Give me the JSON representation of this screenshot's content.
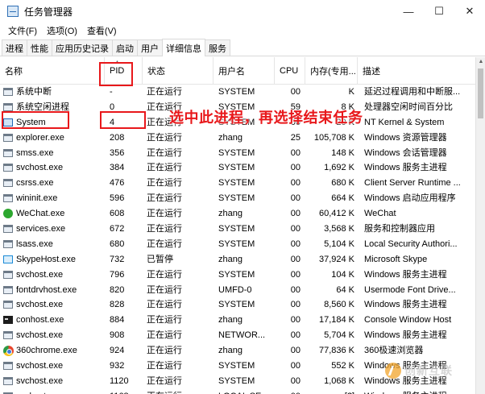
{
  "window": {
    "title": "任务管理器",
    "controls": {
      "minimize": "—",
      "maximize": "☐",
      "close": "✕"
    }
  },
  "menubar": {
    "items": [
      "文件(F)",
      "选项(O)",
      "查看(V)"
    ]
  },
  "tabs": [
    {
      "label": "进程",
      "active": false
    },
    {
      "label": "性能",
      "active": false
    },
    {
      "label": "应用历史记录",
      "active": false
    },
    {
      "label": "启动",
      "active": false
    },
    {
      "label": "用户",
      "active": false
    },
    {
      "label": "详细信息",
      "active": true
    },
    {
      "label": "服务",
      "active": false
    }
  ],
  "table": {
    "columns": {
      "name": "名称",
      "pid": "PID",
      "status": "状态",
      "user": "用户名",
      "cpu": "CPU",
      "mem": "内存(专用...",
      "desc": "描述"
    },
    "sort_indicator": "▲",
    "rows": [
      {
        "icon": "generic",
        "name": "系统中断",
        "pid": "-",
        "status": "正在运行",
        "user": "SYSTEM",
        "cpu": "00",
        "mem": "K",
        "desc": "延迟过程调用和中断服..."
      },
      {
        "icon": "generic",
        "name": "系统空闲进程",
        "pid": "0",
        "status": "正在运行",
        "user": "SYSTEM",
        "cpu": "59",
        "mem": "8 K",
        "desc": "处理器空闲时间百分比"
      },
      {
        "icon": "sys",
        "name": "System",
        "pid": "4",
        "status": "正在运行",
        "user": "SYSTEM",
        "cpu": "00",
        "mem": "20 K",
        "desc": "NT Kernel & System"
      },
      {
        "icon": "generic",
        "name": "explorer.exe",
        "pid": "208",
        "status": "正在运行",
        "user": "zhang",
        "cpu": "25",
        "mem": "105,708 K",
        "desc": "Windows 资源管理器"
      },
      {
        "icon": "generic",
        "name": "smss.exe",
        "pid": "356",
        "status": "正在运行",
        "user": "SYSTEM",
        "cpu": "00",
        "mem": "148 K",
        "desc": "Windows 会话管理器"
      },
      {
        "icon": "generic",
        "name": "svchost.exe",
        "pid": "384",
        "status": "正在运行",
        "user": "SYSTEM",
        "cpu": "00",
        "mem": "1,692 K",
        "desc": "Windows 服务主进程"
      },
      {
        "icon": "generic",
        "name": "csrss.exe",
        "pid": "476",
        "status": "正在运行",
        "user": "SYSTEM",
        "cpu": "00",
        "mem": "680 K",
        "desc": "Client Server Runtime ..."
      },
      {
        "icon": "generic",
        "name": "wininit.exe",
        "pid": "596",
        "status": "正在运行",
        "user": "SYSTEM",
        "cpu": "00",
        "mem": "664 K",
        "desc": "Windows 启动应用程序"
      },
      {
        "icon": "wechat",
        "name": "WeChat.exe",
        "pid": "608",
        "status": "正在运行",
        "user": "zhang",
        "cpu": "00",
        "mem": "60,412 K",
        "desc": "WeChat"
      },
      {
        "icon": "generic",
        "name": "services.exe",
        "pid": "672",
        "status": "正在运行",
        "user": "SYSTEM",
        "cpu": "00",
        "mem": "3,568 K",
        "desc": "服务和控制器应用"
      },
      {
        "icon": "generic",
        "name": "lsass.exe",
        "pid": "680",
        "status": "正在运行",
        "user": "SYSTEM",
        "cpu": "00",
        "mem": "5,104 K",
        "desc": "Local Security Authori..."
      },
      {
        "icon": "skype",
        "name": "SkypeHost.exe",
        "pid": "732",
        "status": "已暂停",
        "user": "zhang",
        "cpu": "00",
        "mem": "37,924 K",
        "desc": "Microsoft Skype"
      },
      {
        "icon": "generic",
        "name": "svchost.exe",
        "pid": "796",
        "status": "正在运行",
        "user": "SYSTEM",
        "cpu": "00",
        "mem": "104 K",
        "desc": "Windows 服务主进程"
      },
      {
        "icon": "generic",
        "name": "fontdrvhost.exe",
        "pid": "820",
        "status": "正在运行",
        "user": "UMFD-0",
        "cpu": "00",
        "mem": "64 K",
        "desc": "Usermode Font Drive..."
      },
      {
        "icon": "generic",
        "name": "svchost.exe",
        "pid": "828",
        "status": "正在运行",
        "user": "SYSTEM",
        "cpu": "00",
        "mem": "8,560 K",
        "desc": "Windows 服务主进程"
      },
      {
        "icon": "console",
        "name": "conhost.exe",
        "pid": "884",
        "status": "正在运行",
        "user": "zhang",
        "cpu": "00",
        "mem": "17,184 K",
        "desc": "Console Window Host"
      },
      {
        "icon": "generic",
        "name": "svchost.exe",
        "pid": "908",
        "status": "正在运行",
        "user": "NETWOR...",
        "cpu": "00",
        "mem": "5,704 K",
        "desc": "Windows 服务主进程"
      },
      {
        "icon": "chrome360",
        "name": "360chrome.exe",
        "pid": "924",
        "status": "正在运行",
        "user": "zhang",
        "cpu": "00",
        "mem": "77,836 K",
        "desc": "360极速浏览器"
      },
      {
        "icon": "generic",
        "name": "svchost.exe",
        "pid": "932",
        "status": "正在运行",
        "user": "SYSTEM",
        "cpu": "00",
        "mem": "552 K",
        "desc": "Windows 服务主进程"
      },
      {
        "icon": "generic",
        "name": "svchost.exe",
        "pid": "1120",
        "status": "正在运行",
        "user": "SYSTEM",
        "cpu": "00",
        "mem": "1,068 K",
        "desc": "Windows 服务主进程"
      },
      {
        "icon": "generic",
        "name": "svchost.exe",
        "pid": "1168",
        "status": "正在运行",
        "user": "LOCAL SE...",
        "cpu": "00",
        "mem": "[?]",
        "desc": "Windows 服务主进程"
      }
    ]
  },
  "annotation": {
    "text": "选中此进程，再选择结束任务",
    "color": "#e8181b"
  },
  "watermark": {
    "text": "创新互联",
    "logo_color": "#f2a52c"
  },
  "colors": {
    "highlight_border": "#e8181b",
    "grid_line": "#e5e5e5",
    "accent": "#1e64b4"
  }
}
